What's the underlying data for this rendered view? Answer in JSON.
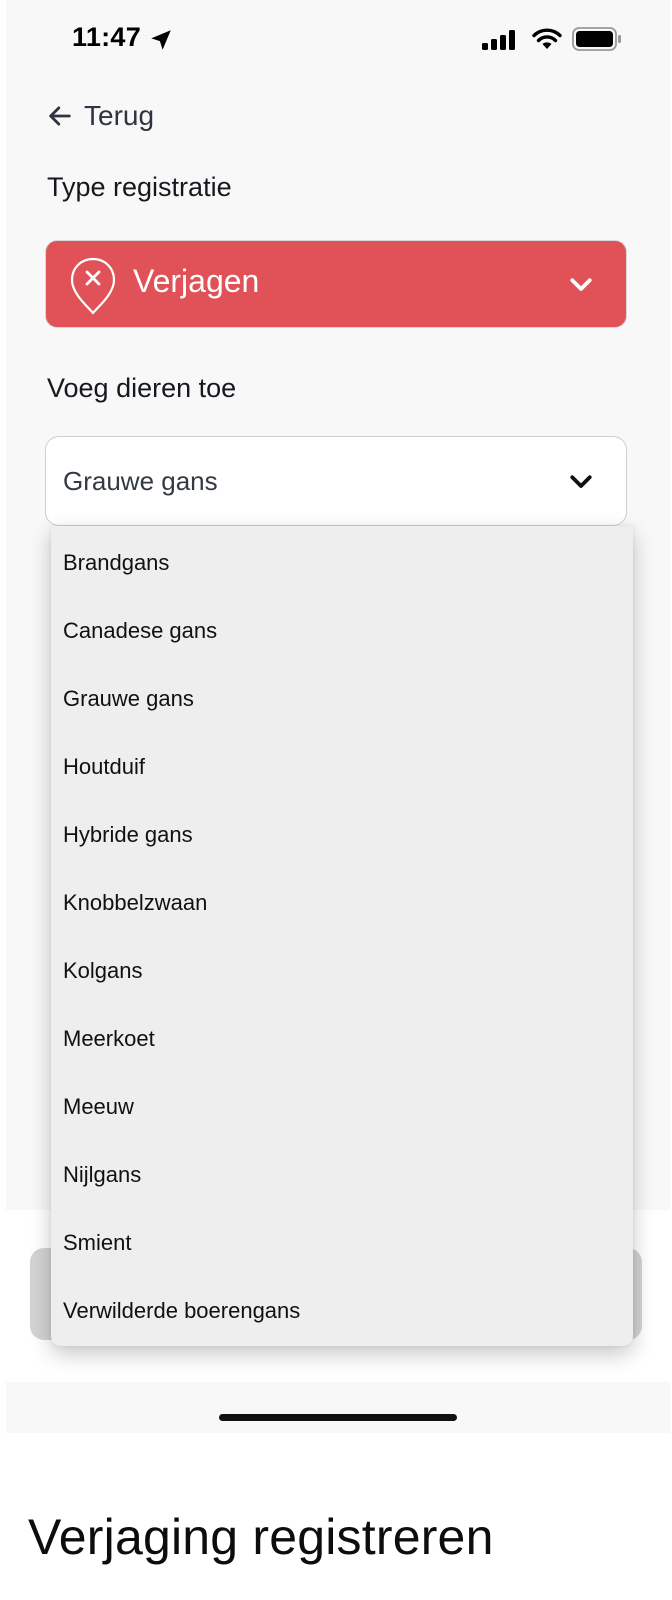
{
  "status_bar": {
    "time": "11:47",
    "icons": [
      "location-arrow-icon",
      "cellular-signal-icon",
      "wifi-icon",
      "battery-icon"
    ]
  },
  "navigation": {
    "back_label": "Terug",
    "back_icon": "arrow-left-icon"
  },
  "registration_type": {
    "label": "Type registratie",
    "selected": "Verjagen",
    "icon": "location-pin-x-icon",
    "chevron_icon": "chevron-down-icon",
    "color": "#e05257"
  },
  "animals": {
    "label": "Voeg dieren toe",
    "selected": "Grauwe gans",
    "chevron_icon": "chevron-down-icon",
    "options": [
      "Brandgans",
      "Canadese gans",
      "Grauwe gans",
      "Houtduif",
      "Hybride gans",
      "Knobbelzwaan",
      "Kolgans",
      "Meerkoet",
      "Meeuw",
      "Nijlgans",
      "Smient",
      "Verwilderde boerengans"
    ]
  },
  "page_title": "Verjaging registreren",
  "colors": {
    "accent_red": "#e05257",
    "background": "#f8f8f8",
    "dropdown_background": "#eeeeee"
  }
}
